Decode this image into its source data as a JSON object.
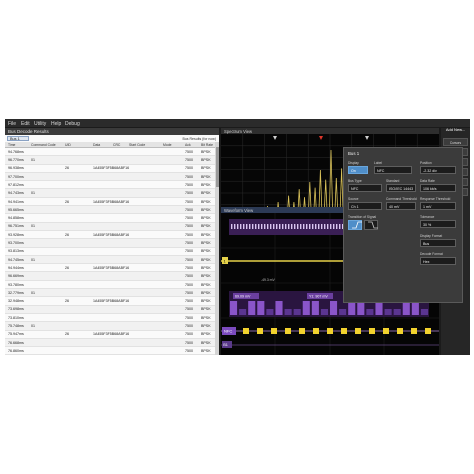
{
  "menu": [
    "File",
    "Edit",
    "Utility",
    "Help",
    "Debug"
  ],
  "bus_table": {
    "title": "Bus Decode Results",
    "tab": "Bus 1 (NFC)",
    "subtitle": "Bus Results (for now)",
    "columns": [
      "Time",
      "Command Code",
      "UID",
      "Data",
      "CRC",
      "Start Code",
      "Mode",
      "Ack",
      "Bit Rate"
    ],
    "rows": [
      [
        "94.768ms",
        "",
        "",
        "",
        "",
        "",
        "",
        "7500",
        "BPSK"
      ],
      [
        "96.770ms",
        "01",
        "",
        "",
        "",
        "",
        "",
        "7500",
        "BPSK"
      ],
      [
        "96.938ms",
        "",
        "26",
        "1A455F3F5B68ABF16",
        "",
        "",
        "",
        "7500",
        "BPSK"
      ],
      [
        "97.700ms",
        "",
        "",
        "",
        "",
        "",
        "",
        "7500",
        "BPSK"
      ],
      [
        "97.812ms",
        "",
        "",
        "",
        "",
        "",
        "",
        "7500",
        "BPSK"
      ],
      [
        "94.743ms",
        "01",
        "",
        "",
        "",
        "",
        "",
        "7500",
        "BPSK"
      ],
      [
        "94.941ms",
        "",
        "26",
        "1A455F3F5B68ABF16",
        "",
        "",
        "",
        "7500",
        "BPSK"
      ],
      [
        "95.665ms",
        "",
        "",
        "",
        "",
        "",
        "",
        "7500",
        "BPSK"
      ],
      [
        "94.858ms",
        "",
        "",
        "",
        "",
        "",
        "",
        "7500",
        "BPSK"
      ],
      [
        "96.751ms",
        "01",
        "",
        "",
        "",
        "",
        "",
        "7500",
        "BPSK"
      ],
      [
        "93.928ms",
        "",
        "26",
        "1A455F3F5B68ABF16",
        "",
        "",
        "",
        "7500",
        "BPSK"
      ],
      [
        "93.700ms",
        "",
        "",
        "",
        "",
        "",
        "",
        "7500",
        "BPSK"
      ],
      [
        "93.813ms",
        "",
        "",
        "",
        "",
        "",
        "",
        "7500",
        "BPSK"
      ],
      [
        "94.745ms",
        "01",
        "",
        "",
        "",
        "",
        "",
        "7500",
        "BPSK"
      ],
      [
        "94.944ms",
        "",
        "26",
        "1A455F3F5B68ABF16",
        "",
        "",
        "",
        "7500",
        "BPSK"
      ],
      [
        "96.669ms",
        "",
        "",
        "",
        "",
        "",
        "",
        "7500",
        "BPSK"
      ],
      [
        "93.780ms",
        "",
        "",
        "",
        "",
        "",
        "",
        "7500",
        "BPSK"
      ],
      [
        "32.779ms",
        "01",
        "",
        "",
        "",
        "",
        "",
        "7500",
        "BPSK"
      ],
      [
        "32.948ms",
        "",
        "26",
        "1A455F3F5B68ABF16",
        "",
        "",
        "",
        "7500",
        "BPSK"
      ],
      [
        "73.698ms",
        "",
        "",
        "",
        "",
        "",
        "",
        "7500",
        "BPSK"
      ],
      [
        "73.810ms",
        "",
        "",
        "",
        "",
        "",
        "",
        "7500",
        "BPSK"
      ],
      [
        "75.748ms",
        "01",
        "",
        "",
        "",
        "",
        "",
        "7500",
        "BPSK"
      ],
      [
        "75.947ms",
        "",
        "26",
        "1A455F3F5B68ABF16",
        "",
        "",
        "",
        "7500",
        "BPSK"
      ],
      [
        "76.668ms",
        "",
        "",
        "",
        "",
        "",
        "",
        "7500",
        "BPSK"
      ],
      [
        "76.860ms",
        "",
        "",
        "",
        "",
        "",
        "",
        "7500",
        "BPSK"
      ],
      [
        "78.753ms",
        "01",
        "",
        "",
        "",
        "",
        "",
        "7500",
        "BPSK"
      ],
      [
        "78.919ms",
        "",
        "26",
        "1A455F3F5B68ABF16",
        "",
        "",
        "",
        "7500",
        "BPSK"
      ],
      [
        "79.676ms",
        "",
        "",
        "",
        "",
        "",
        "",
        "7500",
        "BPSK"
      ],
      [
        "79.788ms",
        "",
        "",
        "",
        "",
        "",
        "",
        "7500",
        "BPSK"
      ]
    ]
  },
  "spectrum": {
    "title": "Spectrum View",
    "peak_heights": [
      0.08,
      0.12,
      0.1,
      0.18,
      0.14,
      0.25,
      0.2,
      0.3,
      0.22,
      0.38,
      0.3,
      0.46,
      0.36,
      0.55,
      0.48,
      0.7,
      0.58,
      0.95,
      0.6,
      0.72,
      0.5,
      0.56,
      0.4,
      0.46,
      0.33,
      0.38,
      0.26,
      0.3,
      0.2,
      0.22,
      0.15,
      0.16,
      0.1,
      0.12,
      0.08
    ]
  },
  "waveform": {
    "title": "Waveform View",
    "bus_label": "NFC",
    "ch1_label": "1",
    "ref_label": "B1",
    "measure_1": "69.09 mV",
    "measure_2": "Y1: 907 mV",
    "note": "-49.3 mV",
    "bits": [
      1,
      0,
      1,
      1,
      0,
      1,
      0,
      0,
      1,
      1,
      0,
      1,
      0,
      1,
      1,
      0,
      1,
      0,
      0,
      1,
      1,
      0
    ]
  },
  "dialog": {
    "title": "Bus 1",
    "display_label": "Display",
    "display_value": "On",
    "label_label": "Label",
    "label_value": "NFC",
    "position_label": "Position",
    "position_value": "-2.32 div",
    "bus_type_label": "Bus Type",
    "bus_type_value": "NFC",
    "standard_label": "Standard",
    "standard_value": "ISO/IEC 14443",
    "data_rate_label": "Data Rate",
    "data_rate_value": "106 kb/s",
    "source_label": "Source",
    "source_value": "Ch 1",
    "command_threshold_label": "Command Threshold",
    "command_threshold_value": "40 mV",
    "response_threshold_label": "Response Threshold",
    "response_threshold_value": "1 mV",
    "transition_label": "Transition of Signal",
    "tolerance_label": "Tolerance",
    "tolerance_value": "30 %",
    "display_format_label": "Display Format",
    "display_format_value": "Bus",
    "decode_format_label": "Decode Format",
    "decode_format_value": "Hex"
  },
  "right_strip": {
    "add_new": "Add New...",
    "buttons": [
      "Cursors",
      "Callout",
      "Math",
      "Bus",
      "Meas",
      "Search"
    ]
  }
}
